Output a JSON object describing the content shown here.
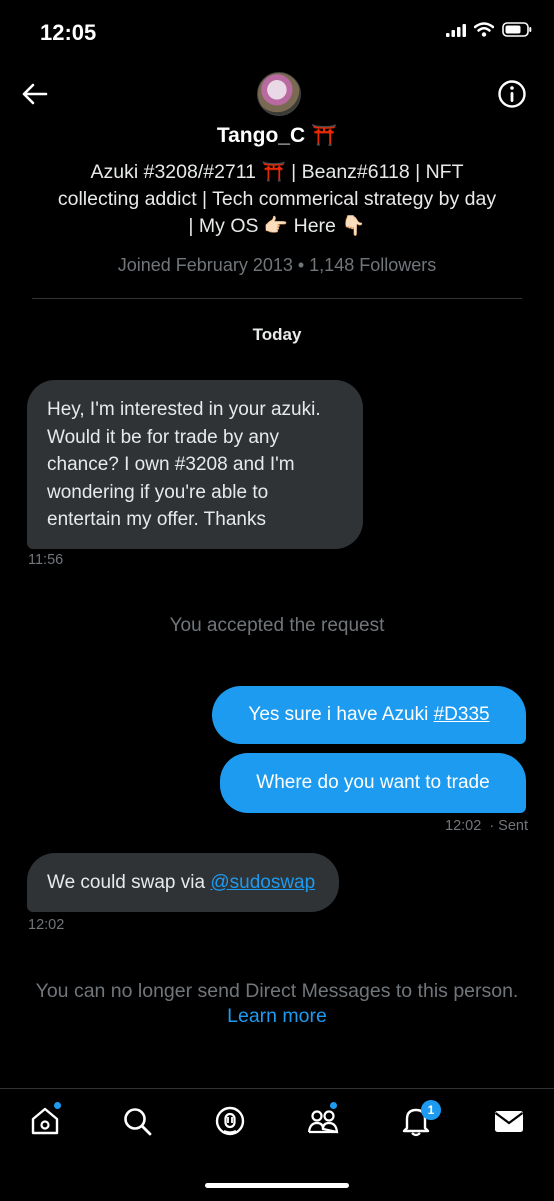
{
  "status_bar": {
    "time": "12:05"
  },
  "profile": {
    "name": "Tango_C ⛩️",
    "bio_line1": "Azuki #3208/#2711 ⛩️ | Beanz#6118 | NFT",
    "bio_line2": "collecting addict | Tech commerical strategy by day",
    "bio_line3": "|  My OS 👉🏻 Here 👇🏻",
    "meta": "Joined February 2013 • 1,148 Followers"
  },
  "conversation": {
    "date_header": "Today",
    "messages": [
      {
        "side": "in",
        "text": "Hey, I'm interested in your azuki. Would it be for trade by any chance? I own #3208 and I'm wondering if you're able to entertain my offer. Thanks",
        "time": "11:56"
      },
      {
        "side": "out",
        "text": "Yes sure i have Azuki ",
        "link": "#D335"
      },
      {
        "side": "out",
        "text": "Where do you want to trade",
        "time": "12:02",
        "status": "· Sent"
      },
      {
        "side": "in",
        "text": "We could swap via ",
        "link": "@sudoswap",
        "time": "12:02"
      }
    ],
    "system_notice": "You accepted the request",
    "restriction_notice": "You can no longer send Direct Messages to this person.",
    "learn_more": "Learn more"
  },
  "tabbar": {
    "notifications_badge": "1"
  },
  "colors": {
    "accent": "#1d9bf0",
    "incoming_bubble": "#2f3336",
    "muted_text": "#71767b"
  }
}
